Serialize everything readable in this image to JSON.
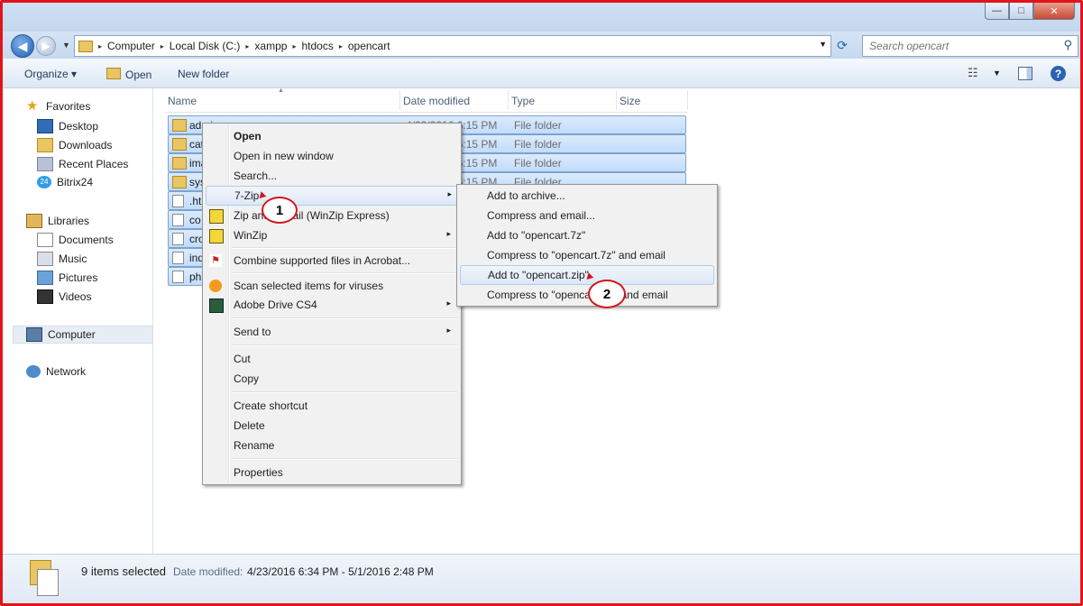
{
  "window": {
    "minimize_glyph": "—",
    "maximize_glyph": "□",
    "close_glyph": "✕"
  },
  "address": {
    "parts": [
      "Computer",
      "Local Disk (C:)",
      "xampp",
      "htdocs",
      "opencart"
    ],
    "separator": "▸"
  },
  "search": {
    "placeholder": "Search opencart"
  },
  "toolbar": {
    "organize_label": "Organize ▾",
    "open_label": "Open",
    "new_folder_label": "New folder"
  },
  "sidebar": {
    "favorites": "Favorites",
    "favorites_items": [
      "Desktop",
      "Downloads",
      "Recent Places",
      "Bitrix24"
    ],
    "libraries": "Libraries",
    "libraries_items": [
      "Documents",
      "Music",
      "Pictures",
      "Videos"
    ],
    "computer": "Computer",
    "network": "Network"
  },
  "columns": {
    "name": "Name",
    "date_modified": "Date modified",
    "type": "Type",
    "size": "Size"
  },
  "files": [
    {
      "name": "admin",
      "date": "4/23/2016 6:15 PM",
      "type": "File folder",
      "kind": "folder"
    },
    {
      "name": "catalog",
      "date": "4/23/2016 6:15 PM",
      "type": "File folder",
      "kind": "folder"
    },
    {
      "name": "image",
      "date": "4/23/2016 6:15 PM",
      "type": "File folder",
      "kind": "folder"
    },
    {
      "name": "system",
      "date": "4/23/2016 6:15 PM",
      "type": "File folder",
      "kind": "folder"
    },
    {
      "name": ".ht",
      "kind": "file"
    },
    {
      "name": "co",
      "kind": "file"
    },
    {
      "name": "cro",
      "kind": "file"
    },
    {
      "name": "ind",
      "kind": "file"
    },
    {
      "name": "ph",
      "kind": "file"
    }
  ],
  "context_menu": {
    "open": "Open",
    "open_new_window": "Open in new window",
    "search": "Search...",
    "seven_zip": "7-Zip",
    "zip_winzip": "Zip and E-Mail (WinZip Express)",
    "winzip": "WinZip",
    "combine_acrobat": "Combine supported files in Acrobat...",
    "scan_viruses": "Scan selected items for viruses",
    "adobe_drive": "Adobe Drive CS4",
    "send_to": "Send to",
    "cut": "Cut",
    "copy": "Copy",
    "create_shortcut": "Create shortcut",
    "delete": "Delete",
    "rename": "Rename",
    "properties": "Properties",
    "arrow": "▸"
  },
  "submenu": {
    "add_archive": "Add to archive...",
    "compress_email": "Compress and email...",
    "add_7z": "Add to \"opencart.7z\"",
    "compress_7z_email": "Compress to \"opencart.7z\" and email",
    "add_zip": "Add to \"opencart.zip\"",
    "compress_zip_email": "Compress to \"opencart.zip\" and email"
  },
  "callouts": {
    "one": "1",
    "two": "2"
  },
  "status": {
    "count": "9 items selected",
    "label": "Date modified:",
    "value": "4/23/2016 6:34 PM - 5/1/2016 2:48 PM"
  },
  "colors": {
    "frame": "#e2131b",
    "callout": "#d4161c",
    "selection": "#c1dcfc"
  }
}
